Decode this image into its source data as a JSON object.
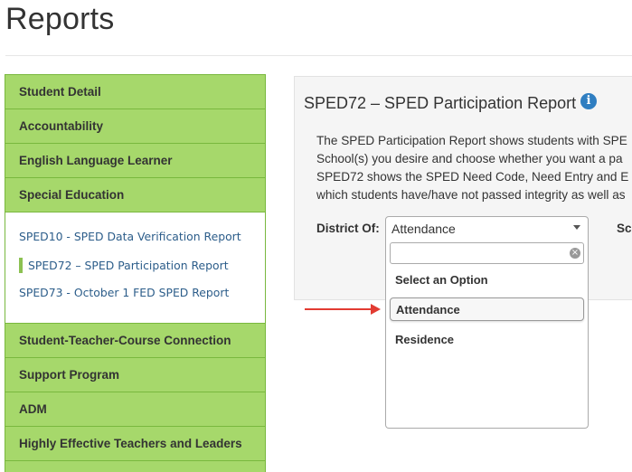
{
  "page": {
    "title": "Reports"
  },
  "sidebar": {
    "categories_top": [
      "Student Detail",
      "Accountability",
      "English Language Learner",
      "Special Education"
    ],
    "subitems": [
      {
        "label": "SPED10 - SPED Data Verification Report",
        "active": false
      },
      {
        "label": "SPED72 – SPED Participation Report",
        "active": true
      },
      {
        "label": "SPED73 - October 1 FED SPED Report",
        "active": false
      }
    ],
    "categories_bottom": [
      "Student-Teacher-Course Connection",
      "Support Program",
      "ADM",
      "Highly Effective Teachers and Leaders"
    ]
  },
  "report": {
    "title": "SPED72 – SPED Participation Report",
    "info_icon": "info-circle-icon",
    "description_lines": [
      "The SPED Participation Report shows students with SPE",
      "School(s) you desire and choose whether you want a pa",
      "SPED72 shows the SPED Need Code, Need Entry and E",
      "which students have/have not passed integrity as well as"
    ],
    "district_label": "District Of:",
    "district_value": "Attendance",
    "school_label_partial": "Sc"
  },
  "dropdown": {
    "search_value": "",
    "options": [
      {
        "label": "Select an Option",
        "highlighted": false
      },
      {
        "label": "Attendance",
        "highlighted": true
      },
      {
        "label": "Residence",
        "highlighted": false
      }
    ]
  },
  "colors": {
    "sidebar_green": "#a6d86b",
    "sidebar_border": "#79b83e",
    "link_blue": "#2c5d8a",
    "info_blue": "#2f7ec1",
    "arrow_red": "#e23b32"
  }
}
